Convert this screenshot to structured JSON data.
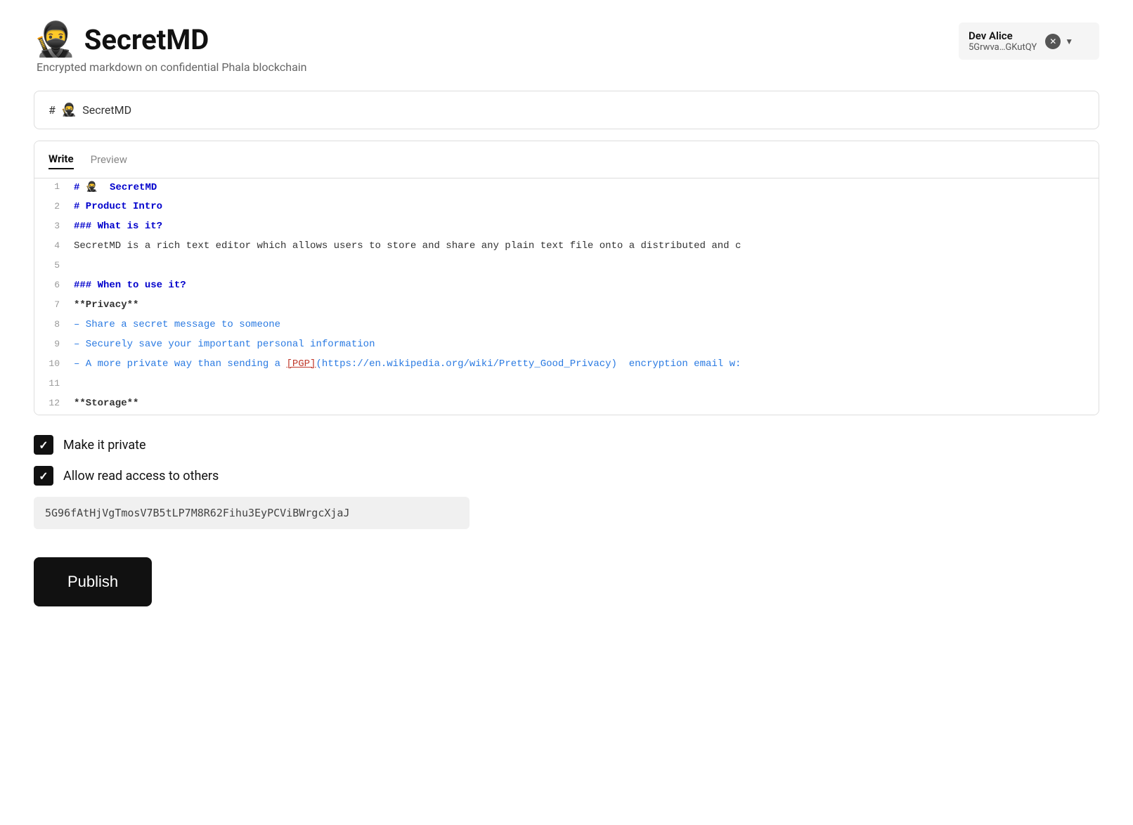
{
  "brand": {
    "logo": "🥷",
    "name": "SecretMD",
    "subtitle": "Encrypted markdown on confidential Phala blockchain"
  },
  "user": {
    "name": "Dev Alice",
    "address": "5Grwva…GKutQY"
  },
  "breadcrumb": {
    "hash": "#",
    "icon": "🥷",
    "title": "SecretMD"
  },
  "editor": {
    "write_tab": "Write",
    "preview_tab": "Preview",
    "lines": [
      {
        "num": "1",
        "content": "# 🥷  SecretMD",
        "type": "heading1"
      },
      {
        "num": "2",
        "content": "# Product Intro",
        "type": "heading1"
      },
      {
        "num": "3",
        "content": "### What is it?",
        "type": "heading3"
      },
      {
        "num": "4",
        "content": "SecretMD is a rich text editor which allows users to store and share any plain text file onto a distributed and c",
        "type": "normal"
      },
      {
        "num": "5",
        "content": "",
        "type": "empty"
      },
      {
        "num": "6",
        "content": "### When to use it?",
        "type": "heading3"
      },
      {
        "num": "7",
        "content": "**Privacy**",
        "type": "bold"
      },
      {
        "num": "8",
        "content": "– Share a secret message to someone",
        "type": "bullet"
      },
      {
        "num": "9",
        "content": "– Securely save your important personal information",
        "type": "bullet"
      },
      {
        "num": "10",
        "content": "– A more private way than sending a [PGP](https://en.wikipedia.org/wiki/Pretty_Good_Privacy)  encryption email w:",
        "type": "bullet-link"
      },
      {
        "num": "11",
        "content": "",
        "type": "empty"
      },
      {
        "num": "12",
        "content": "**Storage**",
        "type": "bold"
      }
    ]
  },
  "options": {
    "make_private_label": "Make it private",
    "allow_read_label": "Allow read access to others",
    "access_key": "5G96fAtHjVgTmosV7B5tLP7M8R62Fihu3EyPCViBWrgcXjaJ"
  },
  "publish_button": "Publish"
}
